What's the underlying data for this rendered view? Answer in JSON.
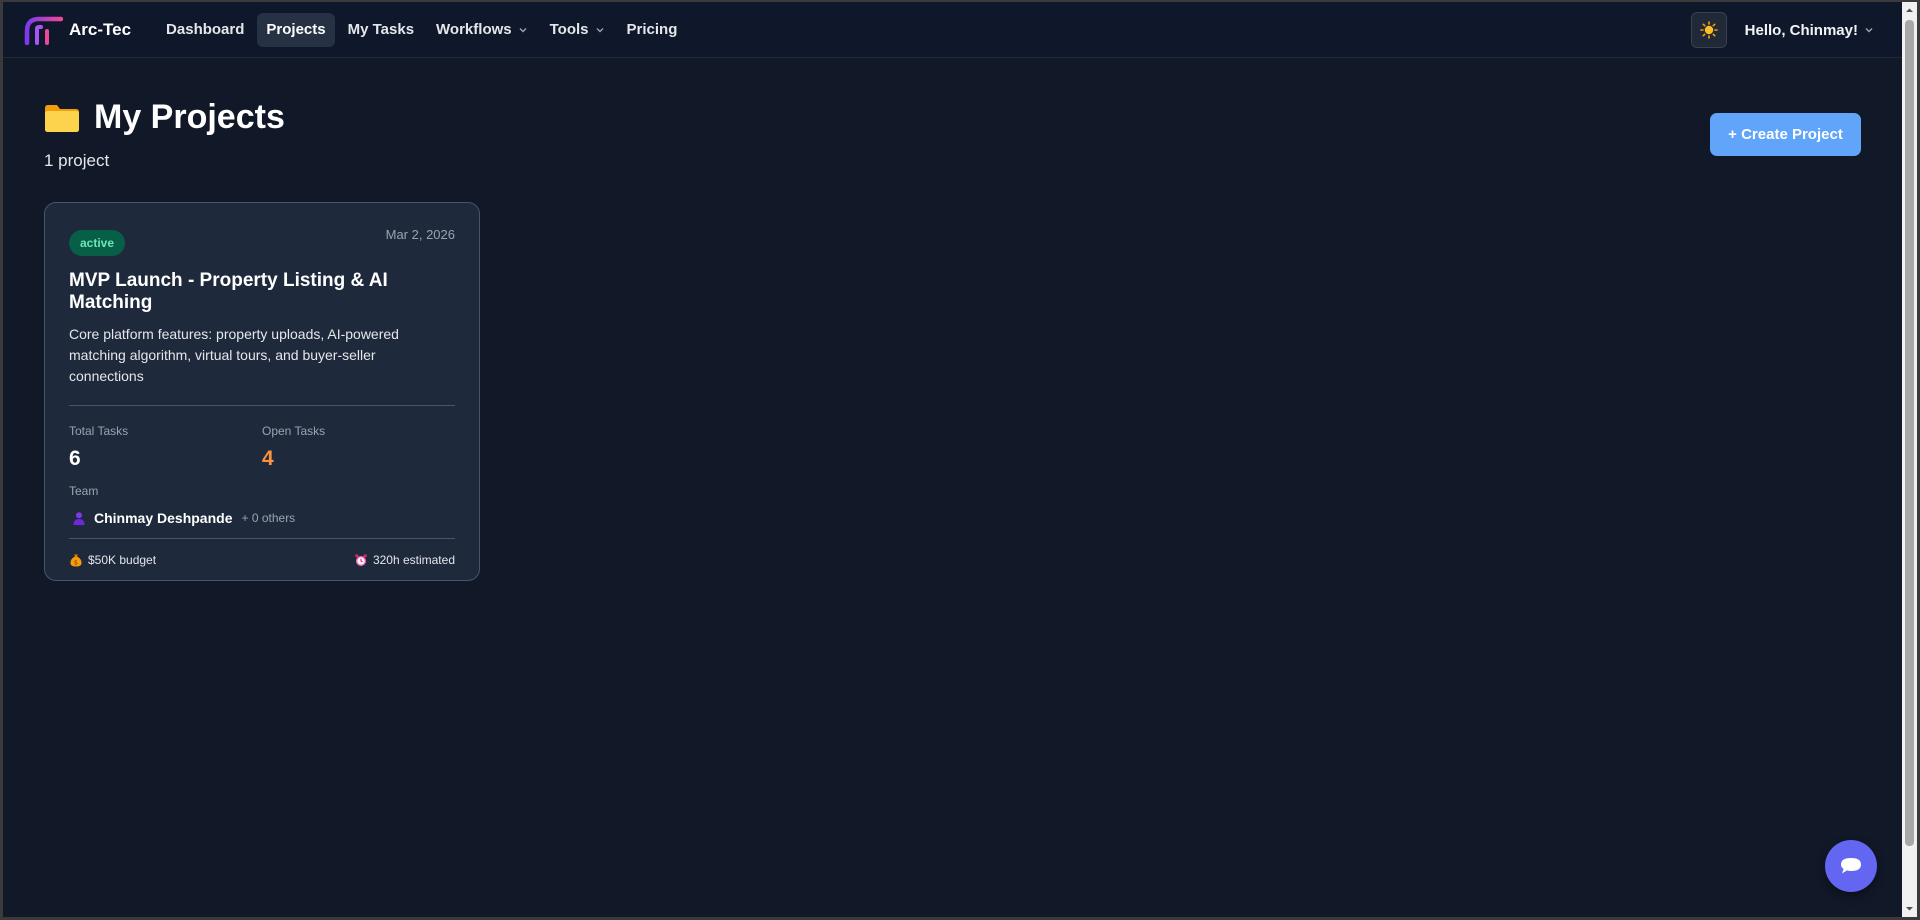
{
  "app": {
    "name": "Arc-Tec"
  },
  "nav": {
    "items": [
      {
        "label": "Dashboard",
        "active": false,
        "dropdown": false
      },
      {
        "label": "Projects",
        "active": true,
        "dropdown": false
      },
      {
        "label": "My Tasks",
        "active": false,
        "dropdown": false
      },
      {
        "label": "Workflows",
        "active": false,
        "dropdown": true
      },
      {
        "label": "Tools",
        "active": false,
        "dropdown": true
      },
      {
        "label": "Pricing",
        "active": false,
        "dropdown": false
      }
    ],
    "greeting": "Hello, Chinmay!",
    "theme_icon": "sun-icon"
  },
  "page": {
    "title": "My Projects",
    "title_icon": "folder-icon",
    "count": "1 project",
    "create_button": "+ Create Project"
  },
  "projects": [
    {
      "status": "active",
      "date": "Mar 2, 2026",
      "title": "MVP Launch - Property Listing & AI Matching",
      "description": "Core platform features: property uploads, AI-powered matching algorithm, virtual tours, and buyer-seller connections",
      "total_tasks_label": "Total Tasks",
      "total_tasks": "6",
      "open_tasks_label": "Open Tasks",
      "open_tasks": "4",
      "team_label": "Team",
      "member": "Chinmay Deshpande",
      "others": "+ 0 others",
      "budget": "$50K budget",
      "estimate": "320h estimated"
    }
  ],
  "colors": {
    "background": "#111827",
    "nav": "#0f172a",
    "card": "#1e293b",
    "accent_blue": "#60a5fa",
    "status_green": "#065f46",
    "open_tasks": "#fb923c",
    "chat_fab": "#6366f1"
  }
}
